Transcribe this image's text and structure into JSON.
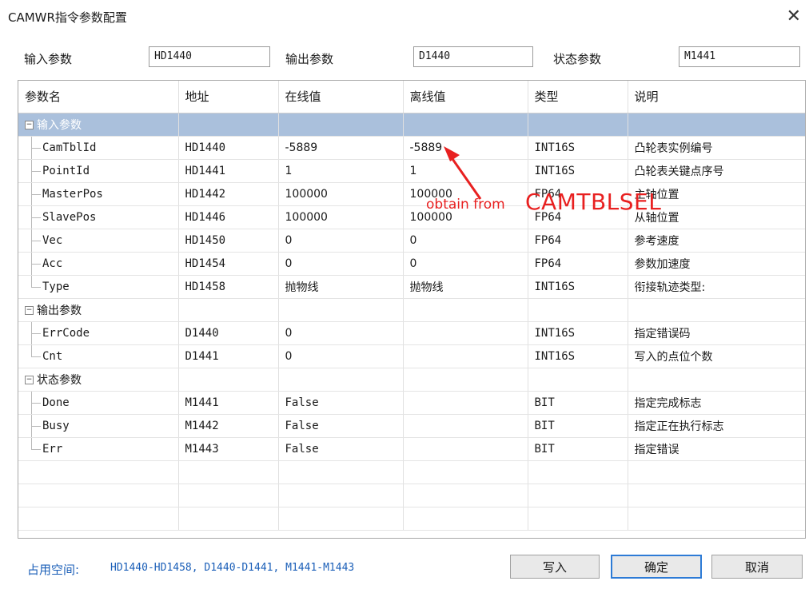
{
  "window": {
    "title": "CAMWR指令参数配置",
    "close_glyph": "✕"
  },
  "params": {
    "input_label": "输入参数",
    "input_value": "HD1440",
    "output_label": "输出参数",
    "output_value": "D1440",
    "status_label": "状态参数",
    "status_value": "M1441"
  },
  "grid": {
    "headers": [
      "参数名",
      "地址",
      "在线值",
      "离线值",
      "类型",
      "说明"
    ],
    "groups": [
      {
        "name": "输入参数",
        "expander": "−",
        "rows": [
          {
            "name": "CamTblId",
            "address": "HD1440",
            "online": "-5889",
            "offline": "-5889",
            "type": "INT16S",
            "desc": "凸轮表实例编号"
          },
          {
            "name": "PointId",
            "address": "HD1441",
            "online": "1",
            "offline": "1",
            "type": "INT16S",
            "desc": "凸轮表关键点序号"
          },
          {
            "name": "MasterPos",
            "address": "HD1442",
            "online": "100000",
            "offline": "100000",
            "type": "FP64",
            "desc": "主轴位置"
          },
          {
            "name": "SlavePos",
            "address": "HD1446",
            "online": "100000",
            "offline": "100000",
            "type": "FP64",
            "desc": "从轴位置"
          },
          {
            "name": "Vec",
            "address": "HD1450",
            "online": "0",
            "offline": "0",
            "type": "FP64",
            "desc": "参考速度"
          },
          {
            "name": "Acc",
            "address": "HD1454",
            "online": "0",
            "offline": "0",
            "type": "FP64",
            "desc": "参数加速度"
          },
          {
            "name": "Type",
            "address": "HD1458",
            "online": "抛物线",
            "offline": "抛物线",
            "type": "INT16S",
            "desc": "衔接轨迹类型:"
          }
        ]
      },
      {
        "name": "输出参数",
        "expander": "−",
        "rows": [
          {
            "name": "ErrCode",
            "address": "D1440",
            "online": "0",
            "offline": "",
            "type": "INT16S",
            "desc": "指定错误码"
          },
          {
            "name": "Cnt",
            "address": "D1441",
            "online": "0",
            "offline": "",
            "type": "INT16S",
            "desc": "写入的点位个数"
          }
        ]
      },
      {
        "name": "状态参数",
        "expander": "−",
        "rows": [
          {
            "name": "Done",
            "address": "M1441",
            "online": "False",
            "offline": "",
            "type": "BIT",
            "desc": "指定完成标志"
          },
          {
            "name": "Busy",
            "address": "M1442",
            "online": "False",
            "offline": "",
            "type": "BIT",
            "desc": "指定正在执行标志"
          },
          {
            "name": "Err",
            "address": "M1443",
            "online": "False",
            "offline": "",
            "type": "BIT",
            "desc": "指定错误"
          }
        ]
      }
    ]
  },
  "annotation": {
    "small": "obtain from",
    "big": "CAMTBLSEL",
    "color": "#e82020"
  },
  "footer": {
    "space_label": "占用空间:",
    "space_value": "HD1440-HD1458, D1440-D1441, M1441-M1443",
    "write_label": "写入",
    "ok_label": "确定",
    "cancel_label": "取消"
  },
  "colors": {
    "selected_row": "#aac0dc",
    "accent": "#1b5fb8",
    "primary_border": "#2d7bd6"
  }
}
